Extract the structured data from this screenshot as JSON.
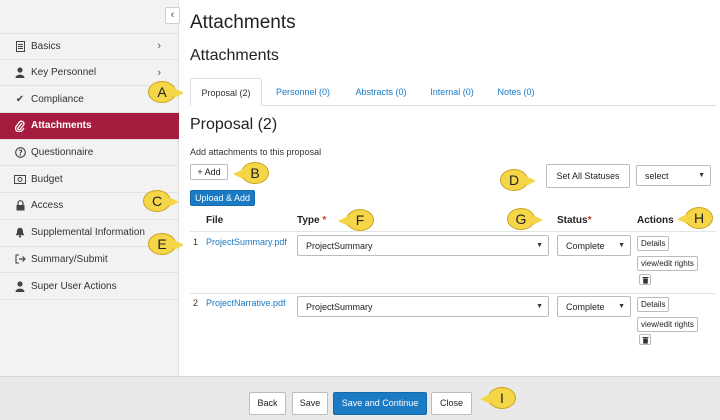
{
  "sidebar": {
    "collapse_glyph": "‹",
    "items": [
      {
        "label": "Basics",
        "icon": "document-icon",
        "has_chevron": true
      },
      {
        "label": "Key Personnel",
        "icon": "person-icon",
        "has_chevron": true
      },
      {
        "label": "Compliance",
        "icon": "check-icon",
        "has_chevron": false
      },
      {
        "label": "Attachments",
        "icon": "paperclip-icon",
        "has_chevron": false,
        "active": true
      },
      {
        "label": "Questionnaire",
        "icon": "question-icon",
        "has_chevron": false
      },
      {
        "label": "Budget",
        "icon": "money-icon",
        "has_chevron": false
      },
      {
        "label": "Access",
        "icon": "lock-icon",
        "has_chevron": false
      },
      {
        "label": "Supplemental Information",
        "icon": "bell-icon",
        "has_chevron": false
      },
      {
        "label": "Summary/Submit",
        "icon": "submit-icon",
        "has_chevron": false
      },
      {
        "label": "Super User Actions",
        "icon": "person-icon",
        "has_chevron": false
      }
    ],
    "active_color": "#a51c3f"
  },
  "header": {
    "page_title": "Attachments",
    "section_title": "Attachments"
  },
  "tabs": [
    {
      "label": "Proposal (2)",
      "active": true
    },
    {
      "label": "Personnel (0)"
    },
    {
      "label": "Abstracts (0)"
    },
    {
      "label": "Internal (0)"
    },
    {
      "label": "Notes (0)"
    }
  ],
  "proposal": {
    "title": "Proposal (2)",
    "hint": "Add attachments to this proposal",
    "add_label": "+ Add",
    "upload_label": "Upload & Add",
    "set_all_label": "Set All Statuses",
    "select_value": "select"
  },
  "table": {
    "headers": {
      "file": "File",
      "type": "Type",
      "status": "Status",
      "actions": "Actions",
      "required_mark": "*"
    },
    "rows": [
      {
        "num": "1",
        "file": "ProjectSummary.pdf",
        "type": "ProjectSummary",
        "status": "Complete",
        "details": "Details",
        "rights": "view/edit rights"
      },
      {
        "num": "2",
        "file": "ProjectNarrative.pdf",
        "type": "ProjectSummary",
        "status": "Complete",
        "details": "Details",
        "rights": "view/edit rights"
      }
    ]
  },
  "footer": {
    "back": "Back",
    "save": "Save",
    "save_continue": "Save and Continue",
    "close": "Close"
  },
  "callouts": [
    "A",
    "B",
    "C",
    "D",
    "E",
    "F",
    "G",
    "H",
    "I"
  ],
  "colors": {
    "link": "#1a7ac3",
    "primary": "#1a7ac3",
    "callout": "#f5d648"
  }
}
